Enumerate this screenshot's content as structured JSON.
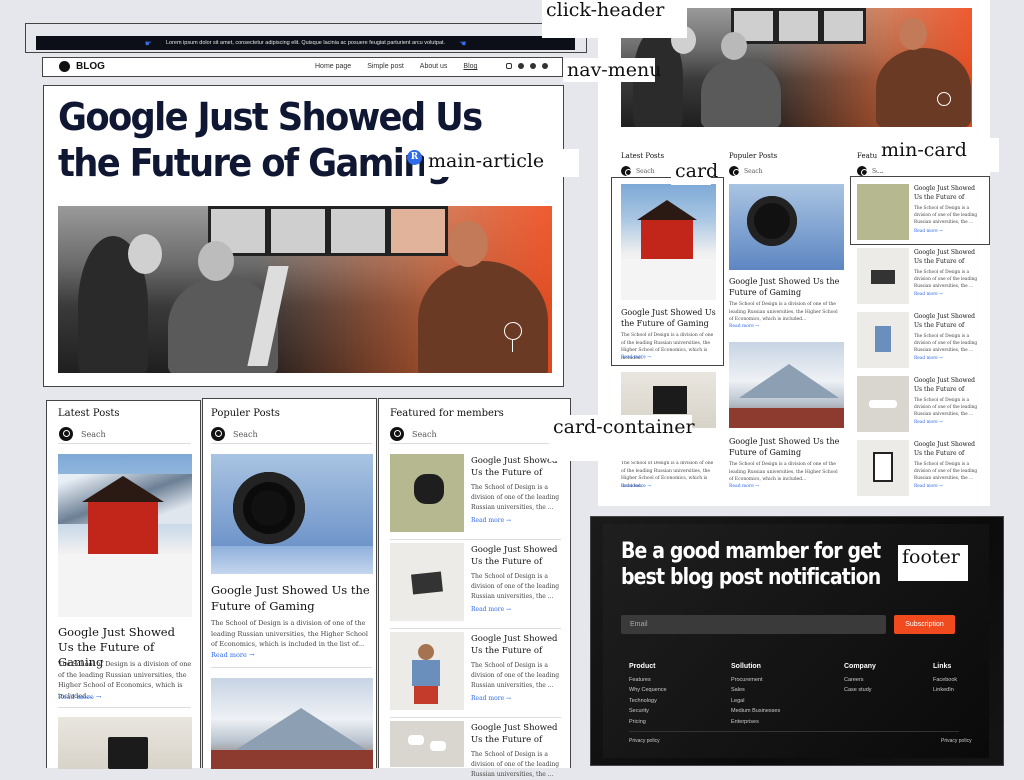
{
  "labels": {
    "click_header": "click-header",
    "nav_menu": "nav-menu",
    "main_article": "main-article",
    "card": "card",
    "min_card": "min-card",
    "card_container": "card-container",
    "footer": "footer"
  },
  "topbar": {
    "text": "Lorem ipsum dolor sit amet, consectetur adipiscing elit. Quisque lacinia ac posuere feugiat parturient arcu volutpat."
  },
  "nav": {
    "logo": "BLOG",
    "items": [
      "Home page",
      "Simple post",
      "About us",
      "Blog"
    ],
    "social_icons": [
      "instagram-icon",
      "facebook-icon",
      "linkedin-icon",
      "dribbble-icon"
    ]
  },
  "hero": {
    "title_line1": "Google Just Showed Us",
    "title_line2": "the Future of Gaming",
    "badge": "R"
  },
  "columns": {
    "latest": {
      "title": "Latest Posts",
      "search": "Seach"
    },
    "popular": {
      "title": "Populer Posts",
      "search": "Seach"
    },
    "featured": {
      "title": "Featured for members",
      "search": "Seach"
    }
  },
  "card": {
    "title": "Google Just Showed Us the Future of Gaming",
    "text": "The School of Design is a division of one of the leading Russian universities, the Higher School of Economics, which is included...",
    "text_alt": "The School of Design is a division of one of the leading Russian universities, the Higher School of Economics, which is included in the list of...",
    "more": "Read more"
  },
  "mini": {
    "title": "Google Just Showed Us the Future of",
    "text": "The School of Design is a division of one of the leading Russian universities, the ...",
    "more": "Read more"
  },
  "preview": {
    "latest": "Latest Posts",
    "popular": "Populer Posts",
    "featured": "Featured",
    "search": "Seach",
    "search_short": "Sea",
    "card_title": "Google Just Showed Us the Future of Gaming",
    "card_text": "The School of Design is a division of one of the leading Russian universities, the Higher School of Economics, which is included...",
    "mini_title": "Google Just Showed Us the Future of",
    "mini_text": "The School of Design is a division of one of the leading Russian universities, the ...",
    "more": "Read more"
  },
  "footer": {
    "headline1": "Be a good mamber for get",
    "headline2": "best blog post notification",
    "email_placeholder": "Email",
    "subscribe": "Subscription",
    "cols": [
      {
        "title": "Product",
        "items": [
          "Features",
          "Why Cequence",
          "Technology",
          "Security",
          "Pricing"
        ]
      },
      {
        "title": "Sollution",
        "items": [
          "Procurement",
          "Sales",
          "Legal",
          "Medium Businesses",
          "Enterprises"
        ]
      },
      {
        "title": "Company",
        "items": [
          "Careers",
          "Case study"
        ]
      },
      {
        "title": "Links",
        "items": [
          "Facebook",
          "LinkedIn"
        ]
      }
    ],
    "privacy_left": "Privacy policy",
    "privacy_right": "Privacy policy"
  },
  "colors": {
    "accent": "#2f6bea",
    "orange": "#f04a1e",
    "dark": "#0f1425"
  }
}
